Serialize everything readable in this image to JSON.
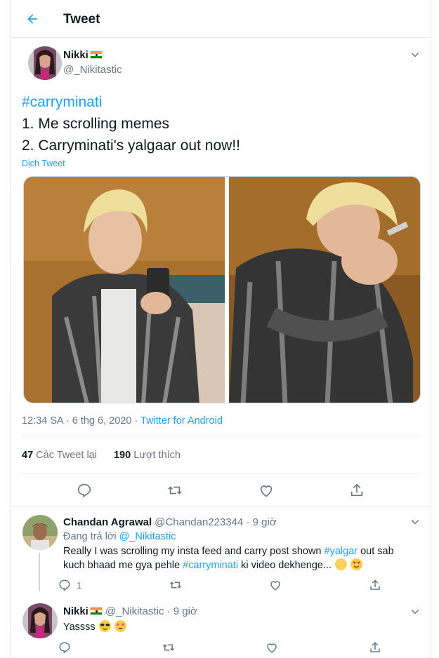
{
  "header": {
    "title": "Tweet"
  },
  "tweet": {
    "author_name": "Nikki",
    "author_handle": "@_Nikitastic",
    "hashtag": "#carryminati",
    "line1": "1. Me scrolling memes",
    "line2": "2. Carryminati's yalgaar out now!!",
    "translate": "Dịch Tweet",
    "time": "12:34 SA · 6 thg 6, 2020 · ",
    "source": "Twitter for Android",
    "retweets_count": "47",
    "retweets_label": "Các Tweet lại",
    "likes_count": "190",
    "likes_label": "Lượt thích"
  },
  "replies": [
    {
      "name": "Chandan Agrawal",
      "handle": "@Chandan223344 · 9 giờ",
      "replying_label": "Đang trả lời ",
      "replying_to": "@_Nikitastic",
      "text_a": "Really I was scrolling my insta feed and carry post shown ",
      "tag_a": "#yalgar",
      "text_b": " out  sab kuch bhaad me gya pehle ",
      "tag_b": "#carryminati",
      "text_c": " ki video dekhenge...",
      "reply_count": "1"
    },
    {
      "name": "Nikki",
      "handle": "@_Nikitastic · 9 giờ",
      "text": "Yassss"
    }
  ],
  "icons": {
    "back": "arrow-left-icon",
    "caret": "chevron-down-icon",
    "reply": "reply-icon",
    "retweet": "retweet-icon",
    "like": "heart-icon",
    "share": "share-icon"
  },
  "colors": {
    "accent": "#1da1f2",
    "muted": "#657786",
    "border": "#e6ecf0"
  }
}
